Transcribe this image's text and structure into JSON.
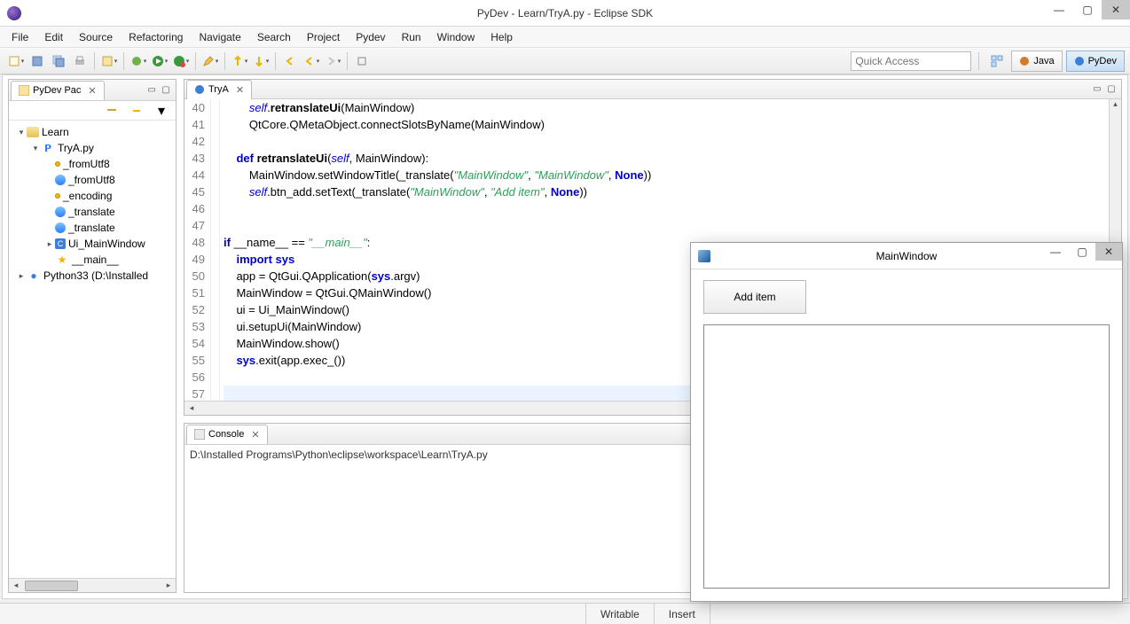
{
  "window": {
    "title": "PyDev - Learn/TryA.py - Eclipse SDK"
  },
  "menu": [
    "File",
    "Edit",
    "Source",
    "Refactoring",
    "Navigate",
    "Search",
    "Project",
    "Pydev",
    "Run",
    "Window",
    "Help"
  ],
  "toolbar": {
    "quick_access_placeholder": "Quick Access"
  },
  "perspectives": {
    "java": "Java",
    "pydev": "PyDev"
  },
  "pkg_explorer": {
    "tab": "PyDev Pac",
    "tree": [
      {
        "depth": 0,
        "expander": "▾",
        "icon": "folder",
        "label": "Learn"
      },
      {
        "depth": 1,
        "expander": "▾",
        "icon": "py",
        "label": "TryA.py"
      },
      {
        "depth": 2,
        "expander": "",
        "icon": "dot",
        "label": "_fromUtf8"
      },
      {
        "depth": 2,
        "expander": "",
        "icon": "globe",
        "label": "_fromUtf8"
      },
      {
        "depth": 2,
        "expander": "",
        "icon": "dot",
        "label": "_encoding"
      },
      {
        "depth": 2,
        "expander": "",
        "icon": "globe",
        "label": "_translate"
      },
      {
        "depth": 2,
        "expander": "",
        "icon": "globe",
        "label": "_translate"
      },
      {
        "depth": 2,
        "expander": "▸",
        "icon": "class",
        "label": "Ui_MainWindow"
      },
      {
        "depth": 2,
        "expander": "",
        "icon": "star",
        "label": "__main__"
      },
      {
        "depth": 0,
        "expander": "▸",
        "icon": "snake",
        "label": "Python33 (D:\\Installed"
      }
    ]
  },
  "editor": {
    "tab": "TryA",
    "first_line": 40,
    "lines": [
      "        self.retranslateUi(MainWindow)",
      "        QtCore.QMetaObject.connectSlotsByName(MainWindow)",
      "",
      "    def retranslateUi(self, MainWindow):",
      "        MainWindow.setWindowTitle(_translate(\"MainWindow\", \"MainWindow\", None))",
      "        self.btn_add.setText(_translate(\"MainWindow\", \"Add item\", None))",
      "",
      "",
      "if __name__ == \"__main__\":",
      "    import sys",
      "    app = QtGui.QApplication(sys.argv)",
      "    MainWindow = QtGui.QMainWindow()",
      "    ui = Ui_MainWindow()",
      "    ui.setupUi(MainWindow)",
      "    MainWindow.show()",
      "    sys.exit(app.exec_())",
      "",
      ""
    ]
  },
  "console": {
    "tab": "Console",
    "line": "D:\\Installed Programs\\Python\\eclipse\\workspace\\Learn\\TryA.py"
  },
  "status": {
    "writable": "Writable",
    "insert": "Insert"
  },
  "qt": {
    "title": "MainWindow",
    "button": "Add item"
  }
}
